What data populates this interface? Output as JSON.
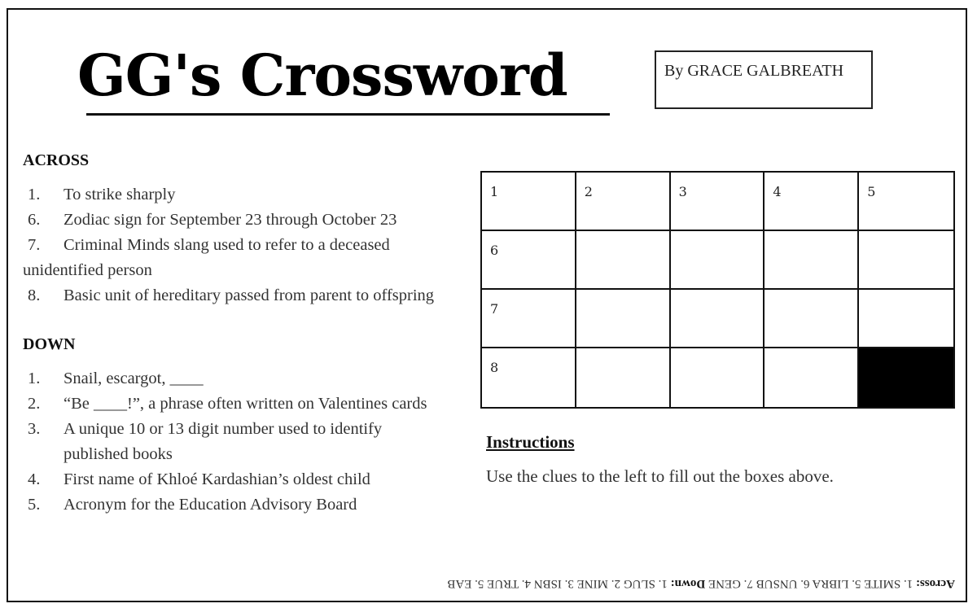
{
  "header": {
    "title": "GG's Crossword",
    "byline": "By GRACE GALBREATH"
  },
  "across": {
    "heading": "ACROSS",
    "clues": [
      {
        "num": "1.",
        "text": "To strike sharply"
      },
      {
        "num": "6.",
        "text": "Zodiac sign for September 23 through October 23"
      },
      {
        "num": "7.",
        "text": "Criminal Minds slang used to refer to a deceased",
        "cont": "unidentified person"
      },
      {
        "num": "8.",
        "text": "Basic unit of hereditary passed from parent to offspring"
      }
    ]
  },
  "down": {
    "heading": "DOWN",
    "clues": [
      {
        "num": "1.",
        "text": "Snail, escargot, ____"
      },
      {
        "num": "2.",
        "text": "“Be ____!”, a phrase often written on Valentines cards"
      },
      {
        "num": "3.",
        "text": "A unique 10 or 13 digit number used to identify",
        "cont": "published books"
      },
      {
        "num": "4.",
        "text": "First name of Khloé Kardashian’s oldest child"
      },
      {
        "num": "5.",
        "text": "Acronym for the Education Advisory Board"
      }
    ]
  },
  "grid": {
    "rows": 4,
    "cols": 5,
    "numbers": [
      [
        "1",
        "2",
        "3",
        "4",
        "5"
      ],
      [
        "6",
        "",
        "",
        "",
        ""
      ],
      [
        "7",
        "",
        "",
        "",
        ""
      ],
      [
        "8",
        "",
        "",
        "",
        ""
      ]
    ],
    "blocks": [
      [
        3,
        4
      ]
    ],
    "block_color": "#000000"
  },
  "instructions": {
    "heading": "Instructions",
    "text": "Use the clues to the left to fill out the boxes above."
  },
  "answer_key": {
    "across_label": "Across:",
    "across_text": " 1. SMITE 5. LIBRA 6. UNSUB 7. GENE ",
    "down_label": "Down:",
    "down_text": " 1. SLUG 2. MINE 3. ISBN 4. TRUE 5. EAB",
    "orientation": "upside-down"
  }
}
